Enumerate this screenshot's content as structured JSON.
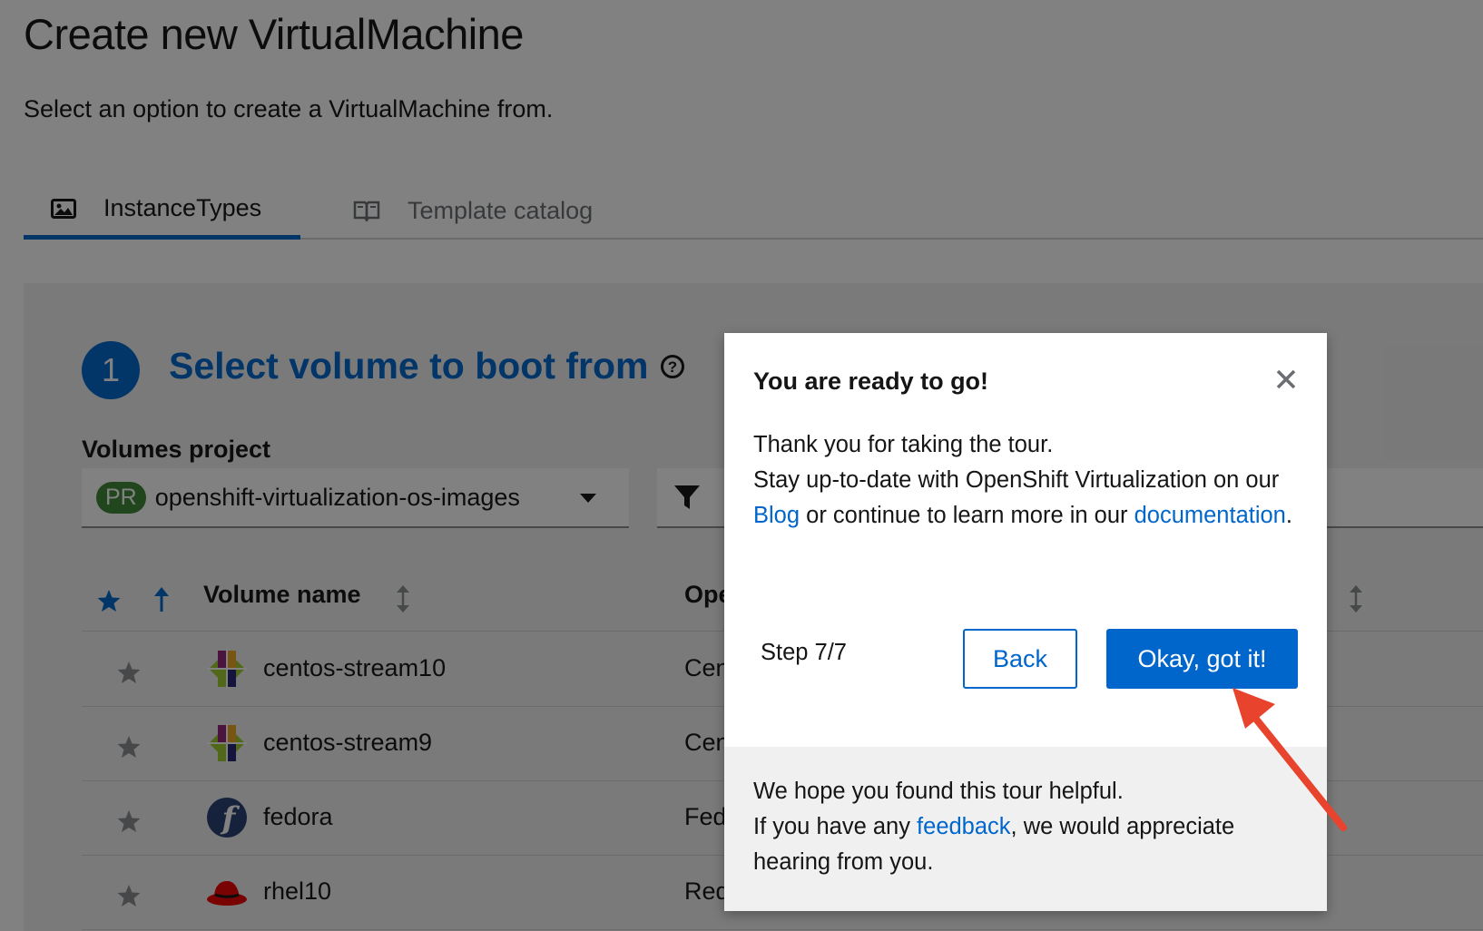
{
  "page": {
    "title": "Create new VirtualMachine",
    "subtitle": "Select an option to create a VirtualMachine from."
  },
  "tabs": [
    {
      "label": "InstanceTypes",
      "icon": "image-icon",
      "active": true
    },
    {
      "label": "Template catalog",
      "icon": "book-icon",
      "active": false
    }
  ],
  "step": {
    "number": "1",
    "title": "Select volume to boot from",
    "help_icon": "help-circle-icon"
  },
  "volumes_project": {
    "label": "Volumes project",
    "badge": "PR",
    "value": "openshift-virtualization-os-images"
  },
  "table": {
    "columns": [
      "Volume name",
      "Ope"
    ],
    "rows": [
      {
        "name": "centos-stream10",
        "os": "Cen",
        "logo": "centos-logo-icon"
      },
      {
        "name": "centos-stream9",
        "os": "Cen",
        "logo": "centos-logo-icon"
      },
      {
        "name": "fedora",
        "os": "Fed",
        "logo": "fedora-logo-icon"
      },
      {
        "name": "rhel10",
        "os": "Red",
        "logo": "redhat-logo-icon"
      }
    ]
  },
  "popover": {
    "title": "You are ready to go!",
    "body_line1": "Thank you for taking the tour.",
    "body_line2_pre": "Stay up-to-date with OpenShift Virtualization on our ",
    "blog_link": "Blog",
    "body_line2_mid": " or continue to learn more in our ",
    "docs_link": "documentation",
    "body_line2_end": ".",
    "step_count": "Step 7/7",
    "back_label": "Back",
    "ok_label": "Okay, got it!",
    "footer_line1": "We hope you found this tour helpful.",
    "footer_pre": "If you have any ",
    "feedback_link": "feedback",
    "footer_post": ", we would appreciate hearing from you."
  },
  "colors": {
    "accent": "#0066cc",
    "annotation_arrow": "#e8432d"
  }
}
